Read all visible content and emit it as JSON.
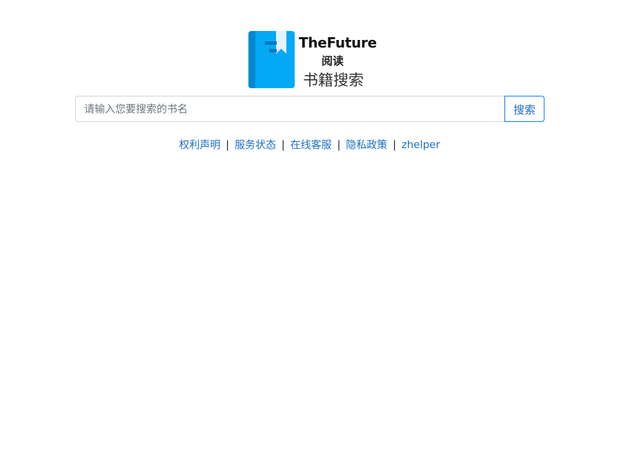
{
  "logo": {
    "brand": "TheFuture",
    "sub": "阅读",
    "caption": "书籍搜索"
  },
  "search": {
    "placeholder": "请输入您要搜索的书名",
    "value": "",
    "button_label": "搜索"
  },
  "links": {
    "items": [
      "权利声明",
      "服务状态",
      "在线客服",
      "隐私政策",
      "zhelper"
    ],
    "separator": "|"
  },
  "colors": {
    "link": "#1a6fc4",
    "accent": "#03a9f4",
    "button_border": "#007bff"
  }
}
